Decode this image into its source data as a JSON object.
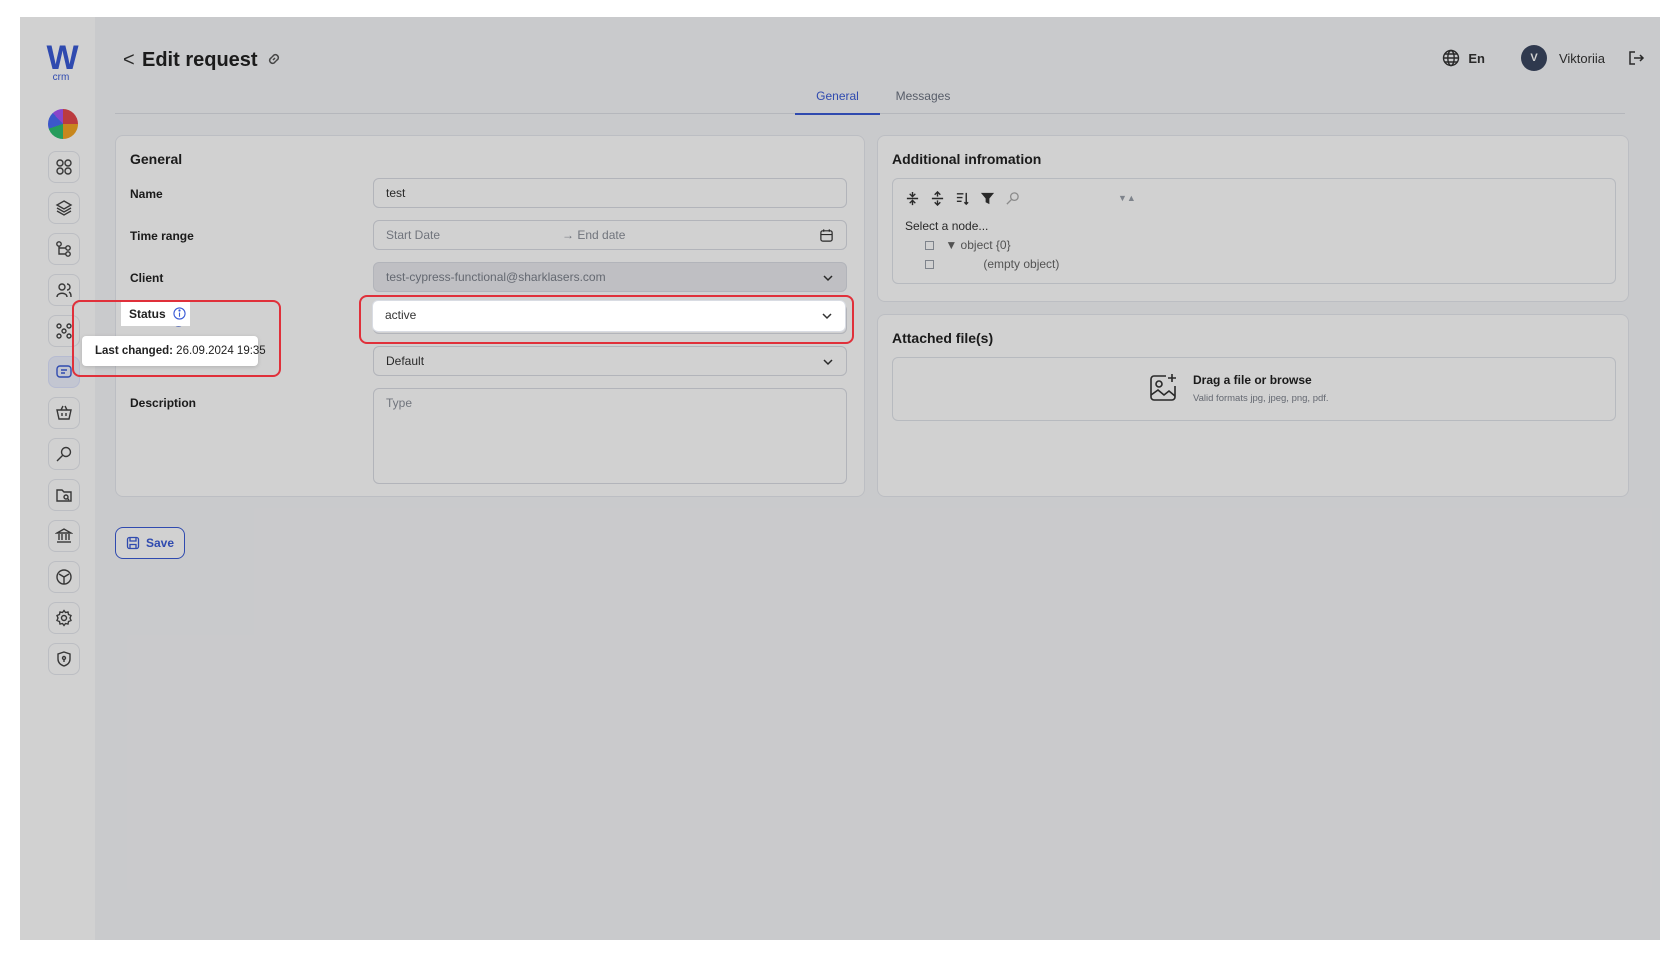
{
  "app": {
    "logo_letter": "W",
    "logo_sub": "crm"
  },
  "sidebar": {
    "items": [
      {
        "icon": "dashboard-grid-icon"
      },
      {
        "icon": "layers-icon"
      },
      {
        "icon": "hierarchy-icon"
      },
      {
        "icon": "users-icon"
      },
      {
        "icon": "org-structure-icon"
      },
      {
        "icon": "requests-icon",
        "active": true
      },
      {
        "icon": "basket-icon"
      },
      {
        "icon": "key-search-icon"
      },
      {
        "icon": "folder-search-icon"
      },
      {
        "icon": "bank-icon"
      },
      {
        "icon": "box-icon"
      },
      {
        "icon": "settings-icon"
      },
      {
        "icon": "shield-icon"
      }
    ]
  },
  "header": {
    "back_symbol": "<",
    "title": "Edit request",
    "language": "En",
    "user_initial": "V",
    "user_name": "Viktoriia"
  },
  "tabs": [
    {
      "label": "General",
      "active": true
    },
    {
      "label": "Messages",
      "active": false
    }
  ],
  "general": {
    "title": "General",
    "name_label": "Name",
    "name_value": "test",
    "time_range_label": "Time range",
    "start_placeholder": "Start Date",
    "end_placeholder": "→ End date",
    "client_label": "Client",
    "client_value": "test-cypress-functional@sharklasers.com",
    "status_label": "Status",
    "status_value": "active",
    "priority_value": "Default",
    "description_label": "Description",
    "description_placeholder": "Type"
  },
  "tooltip": {
    "prefix": "Last changed:",
    "value": "26.09.2024 19:35"
  },
  "additional": {
    "title": "Additional infromation",
    "select_node": "Select a node...",
    "tree_root": "▼  object  {0}",
    "tree_empty": "(empty object)",
    "sort_arrows": "▼▲"
  },
  "attachments": {
    "title": "Attached file(s)",
    "drop_title": "Drag a file or browse",
    "drop_hint": "Valid formats jpg, jpeg, png, pdf."
  },
  "actions": {
    "save_label": "Save"
  },
  "colors": {
    "accent": "#3a5bd6",
    "highlight": "#e0303a"
  }
}
